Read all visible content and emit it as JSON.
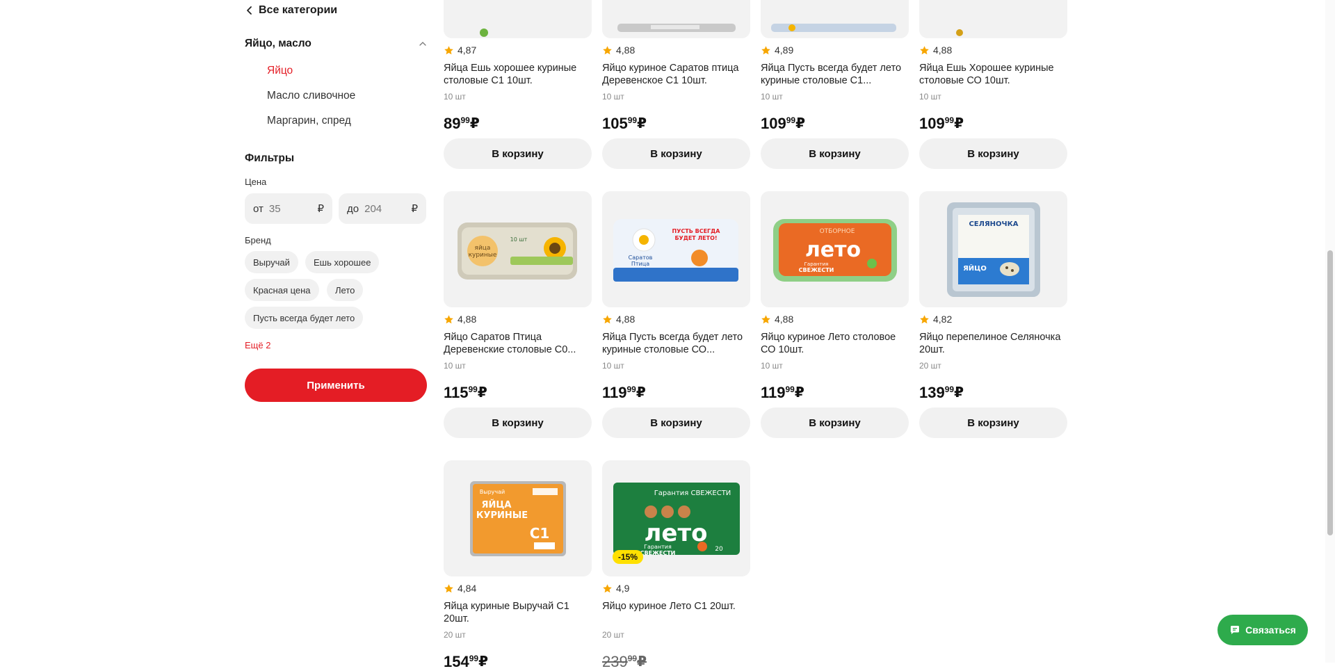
{
  "sidebar": {
    "back_label": "Все категории",
    "category_title": "Яйцо, масло",
    "subcategories": [
      "Яйцо",
      "Масло сливочное",
      "Маргарин, спред"
    ],
    "filters_title": "Фильтры",
    "price_label": "Цена",
    "price_from_prefix": "от",
    "price_from_placeholder": "35",
    "price_to_prefix": "до",
    "price_to_placeholder": "204",
    "currency": "₽",
    "brand_label": "Бренд",
    "brands": [
      "Выручай",
      "Ешь хорошее",
      "Красная цена",
      "Лето",
      "Пусть всегда будет лето"
    ],
    "more_label": "Ещё 2",
    "apply_label": "Применить"
  },
  "products": [
    {
      "rating": "4,87",
      "title": "Яйца Ешь хорошее куриные столовые С1 10шт.",
      "qty": "10 шт",
      "price_int": "89",
      "price_dec": "99"
    },
    {
      "rating": "4,88",
      "title": "Яйцо куриное Саратов птица Деревенское С1 10шт.",
      "qty": "10 шт",
      "price_int": "105",
      "price_dec": "99"
    },
    {
      "rating": "4,89",
      "title": "Яйца Пусть всегда будет лето куриные столовые С1...",
      "qty": "10 шт",
      "price_int": "109",
      "price_dec": "99"
    },
    {
      "rating": "4,88",
      "title": "Яйца Ешь Хорошее куриные столовые СО 10шт.",
      "qty": "10 шт",
      "price_int": "109",
      "price_dec": "99"
    },
    {
      "rating": "4,88",
      "title": "Яйцо Саратов Птица Деревенские столовые С0...",
      "qty": "10 шт",
      "price_int": "115",
      "price_dec": "99"
    },
    {
      "rating": "4,88",
      "title": "Яйца Пусть всегда будет лето куриные столовые СО...",
      "qty": "10 шт",
      "price_int": "119",
      "price_dec": "99"
    },
    {
      "rating": "4,88",
      "title": "Яйцо куриное Лето столовое СО 10шт.",
      "qty": "10 шт",
      "price_int": "119",
      "price_dec": "99"
    },
    {
      "rating": "4,82",
      "title": "Яйцо перепелиное Селяночка 20шт.",
      "qty": "20 шт",
      "price_int": "139",
      "price_dec": "99"
    },
    {
      "rating": "4,84",
      "title": "Яйца куриные Выручай С1 20шт.",
      "qty": "20 шт",
      "price_int": "154",
      "price_dec": "99"
    },
    {
      "rating": "4,9",
      "title": "Яйцо куриное Лето С1 20шт.",
      "qty": "20 шт",
      "price_int": "239",
      "price_dec": "99",
      "discount": "-15%"
    }
  ],
  "cart_label": "В корзину",
  "contact_label": "Связаться",
  "package_texts": {
    "p5": [
      "яйца",
      "куриные",
      "10 шт"
    ],
    "p6": [
      "ПУСТЬ ВСЕГДА",
      "БУДЕТ ЛЕТО!",
      "Саратов",
      "Птица"
    ],
    "p7": [
      "ОТБОРНОЕ",
      "лето",
      "Гарантия",
      "СВЕЖЕСТИ"
    ],
    "p8": [
      "СЕЛЯНОЧКА",
      "ЯЙЦО"
    ],
    "p9": [
      "Выручай",
      "ЯЙЦА",
      "КУРИНЫЕ",
      "С1"
    ],
    "p10": [
      "Гарантия СВЕЖЕСТИ",
      "лето",
      "Гарантия",
      "СВЕЖЕСТИ",
      "20"
    ]
  },
  "colors": {
    "accent_red": "#e41d25",
    "star": "#f7a600",
    "contact_green": "#2eab4c",
    "discount_yellow": "#ffe000"
  }
}
